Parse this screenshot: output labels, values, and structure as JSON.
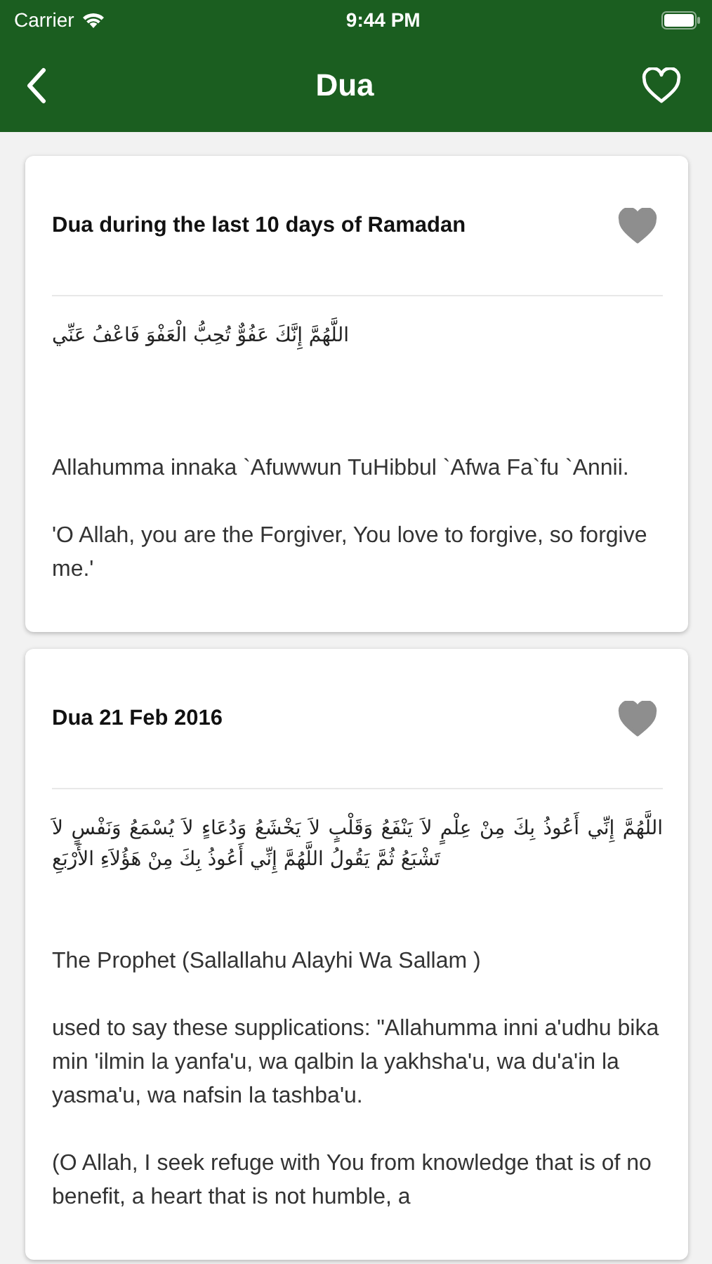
{
  "status_bar": {
    "carrier": "Carrier",
    "time": "9:44 PM"
  },
  "nav": {
    "title": "Dua"
  },
  "cards": [
    {
      "title": "Dua during the last 10 days of Ramadan",
      "arabic": "اللَّهُمَّ إِنَّكَ عَفُوٌّ تُحِبُّ الْعَفْوَ فَاعْفُ عَنِّي",
      "paragraphs": [
        "Allahumma innaka `Afuwwun TuHibbul `Afwa Fa`fu `Annii.",
        "'O Allah, you are the Forgiver, You love to forgive, so forgive me.'"
      ]
    },
    {
      "title": "Dua 21 Feb 2016",
      "arabic": "اللَّهُمَّ إِنِّي أَعُوذُ بِكَ مِنْ عِلْمٍ لاَ يَنْفَعُ وَقَلْبٍ لاَ يَخْشَعُ وَدُعَاءٍ لاَ يُسْمَعُ وَنَفْسٍ لاَ تَشْبَعُ ثُمَّ يَقُولُ اللَّهُمَّ إِنِّي أَعُوذُ بِكَ مِنْ هَؤُلاَءِ الأَرْبَعِ",
      "paragraphs": [
        "The Prophet (Sallallahu Alayhi Wa Sallam )",
        "used to say these supplications: \"Allahumma inni a'udhu bika min 'ilmin la yanfa'u, wa qalbin la yakhsha'u, wa du'a'in la yasma'u, wa nafsin la tashba'u.",
        "(O Allah, I seek refuge with You from knowledge that is of no benefit, a heart that is not humble, a"
      ]
    }
  ]
}
